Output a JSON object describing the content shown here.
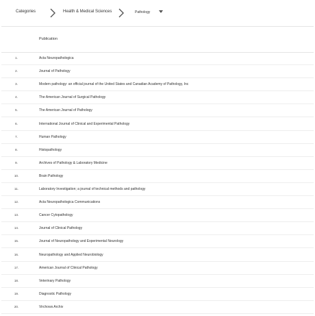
{
  "breadcrumb": {
    "root": "Categories",
    "category": "Health & Medical Sciences",
    "subcategory": "Pathology",
    "separator_icon": "chevron-right-icon",
    "dropdown_icon": "caret-down-icon"
  },
  "table": {
    "header": {
      "rank": "",
      "publication": "Publication"
    },
    "rows": [
      {
        "rank": "1.",
        "name": "Acta Neuropathologica"
      },
      {
        "rank": "2.",
        "name": "Journal of Pathology"
      },
      {
        "rank": "3.",
        "name": "Modern pathology: an official journal of the United States and Canadian Academy of Pathology, Inc"
      },
      {
        "rank": "4.",
        "name": "The American Journal of Surgical Pathology"
      },
      {
        "rank": "5.",
        "name": "The American Journal of Pathology"
      },
      {
        "rank": "6.",
        "name": "International Journal of Clinical and Experimental Pathology"
      },
      {
        "rank": "7.",
        "name": "Human Pathology"
      },
      {
        "rank": "8.",
        "name": "Histopathology"
      },
      {
        "rank": "9.",
        "name": "Archives of Pathology & Laboratory Medicine"
      },
      {
        "rank": "10.",
        "name": "Brain Pathology"
      },
      {
        "rank": "11.",
        "name": "Laboratory Investigation; a journal of technical methods and pathology"
      },
      {
        "rank": "12.",
        "name": "Acta Neuropathologica Communications"
      },
      {
        "rank": "13.",
        "name": "Cancer Cytopathology"
      },
      {
        "rank": "14.",
        "name": "Journal of Clinical Pathology"
      },
      {
        "rank": "15.",
        "name": "Journal of Neuropathology and Experimental Neurology"
      },
      {
        "rank": "16.",
        "name": "Neuropathology and Applied Neurobiology"
      },
      {
        "rank": "17.",
        "name": "American Journal of Clinical Pathology"
      },
      {
        "rank": "18.",
        "name": "Veterinary Pathology"
      },
      {
        "rank": "19.",
        "name": "Diagnostic Pathology"
      },
      {
        "rank": "20.",
        "name": "Virchows Archiv"
      }
    ]
  },
  "colors": {
    "background": "#ffffff",
    "text": "#333333",
    "divider": "#e4e4e4",
    "icon": "#555555"
  }
}
